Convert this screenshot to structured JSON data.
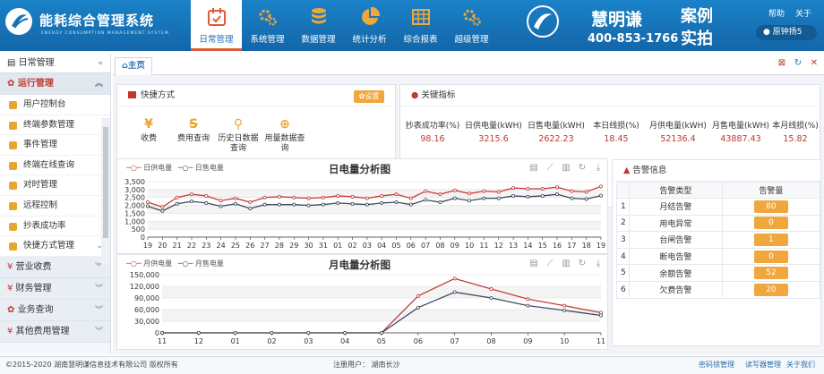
{
  "app": {
    "title": "能耗综合管理系统",
    "subtitle": "ENERGY CONSUMPTION MANAGEMENT SYSTEM"
  },
  "nav": [
    {
      "label": "日常管理",
      "icon": "calendar-icon",
      "active": true
    },
    {
      "label": "系统管理",
      "icon": "gears-icon"
    },
    {
      "label": "数据管理",
      "icon": "database-icon"
    },
    {
      "label": "统计分析",
      "icon": "pie-chart-icon"
    },
    {
      "label": "综合报表",
      "icon": "table-icon"
    },
    {
      "label": "超级管理",
      "icon": "gears-icon"
    }
  ],
  "brand": {
    "name": "慧明谦",
    "phone": "400-853-1766",
    "tagline": "案例实拍"
  },
  "header": {
    "help": "帮助",
    "about": "关于",
    "user": "原钟扬5"
  },
  "sidebar": {
    "title": "日常管理",
    "collapse_icon": "«",
    "open_section": "运行管理",
    "items": [
      "用户控制台",
      "终端参数管理",
      "事件管理",
      "终端在线查询",
      "对时管理",
      "远程控制",
      "抄表成功率",
      "快捷方式管理"
    ],
    "sections": [
      "营业收费",
      "财务管理",
      "业务查询",
      "其他费用管理"
    ]
  },
  "tabs": {
    "home": "主页"
  },
  "shortcuts": {
    "title": "快捷方式",
    "settings": "设置",
    "items": [
      {
        "label": "收费",
        "glyph": "¥"
      },
      {
        "label": "费用查询",
        "glyph": "S"
      },
      {
        "label": "历史日数据查询",
        "glyph": "Q"
      },
      {
        "label": "用量数据查询",
        "glyph": "Q"
      }
    ]
  },
  "kpi": {
    "title": "关键指标",
    "items": [
      {
        "label": "抄表成功率(%)",
        "value": "98.16"
      },
      {
        "label": "日供电量(kWH)",
        "value": "3215.6"
      },
      {
        "label": "日售电量(kWH)",
        "value": "2622.23"
      },
      {
        "label": "本日线损(%)",
        "value": "18.45"
      },
      {
        "label": "月供电量(kWH)",
        "value": "52136.4"
      },
      {
        "label": "月售电量(kWH)",
        "value": "43887.43"
      },
      {
        "label": "本月线损(%)",
        "value": "15.82"
      }
    ]
  },
  "colors": {
    "supply": "#c63c3a",
    "sale": "#3d4b5e",
    "accent": "#f0a73d",
    "header": "#1672b8"
  },
  "chart_data": [
    {
      "type": "line",
      "title": "日电量分析图",
      "x": [
        "19",
        "20",
        "21",
        "22",
        "23",
        "24",
        "25",
        "26",
        "27",
        "28",
        "29",
        "30",
        "31",
        "01",
        "02",
        "03",
        "04",
        "05",
        "06",
        "07",
        "08",
        "09",
        "10",
        "11",
        "12",
        "13",
        "14",
        "15",
        "16",
        "17",
        "18",
        "19"
      ],
      "series": [
        {
          "name": "日供电量",
          "values": [
            2200,
            1900,
            2500,
            2700,
            2600,
            2300,
            2450,
            2200,
            2500,
            2550,
            2500,
            2450,
            2500,
            2600,
            2550,
            2450,
            2600,
            2700,
            2450,
            2900,
            2700,
            2950,
            2750,
            2900,
            2850,
            3100,
            3050,
            3050,
            3150,
            2900,
            2850,
            3200
          ]
        },
        {
          "name": "日售电量",
          "values": [
            1950,
            1650,
            2100,
            2250,
            2150,
            1950,
            2100,
            1800,
            2050,
            2050,
            2050,
            2000,
            2050,
            2150,
            2100,
            2050,
            2150,
            2200,
            2050,
            2350,
            2200,
            2450,
            2300,
            2450,
            2450,
            2600,
            2550,
            2600,
            2700,
            2450,
            2400,
            2620
          ]
        }
      ],
      "ylim": [
        0,
        3500
      ],
      "yticks": [
        "0",
        "500",
        "1,000",
        "1,500",
        "2,000",
        "2,500",
        "3,000",
        "3,500"
      ]
    },
    {
      "type": "line",
      "title": "月电量分析图",
      "x": [
        "11",
        "12",
        "01",
        "02",
        "03",
        "04",
        "05",
        "06",
        "07",
        "08",
        "09",
        "10",
        "11"
      ],
      "series": [
        {
          "name": "月供电量",
          "values": [
            0,
            0,
            0,
            0,
            0,
            0,
            0,
            95000,
            140000,
            113000,
            87000,
            70000,
            52000
          ]
        },
        {
          "name": "月售电量",
          "values": [
            0,
            0,
            0,
            0,
            0,
            0,
            0,
            65000,
            105000,
            90000,
            70000,
            58000,
            45000
          ]
        }
      ],
      "ylim": [
        0,
        150000
      ],
      "yticks": [
        "0",
        "30,000",
        "60,000",
        "90,000",
        "120,000",
        "150,000"
      ]
    }
  ],
  "alarm": {
    "title": "告警信息",
    "headers": [
      "告警类型",
      "告警量"
    ],
    "rows": [
      {
        "no": "1",
        "type": "月结告警",
        "count": "80"
      },
      {
        "no": "2",
        "type": "用电异常",
        "count": "0"
      },
      {
        "no": "3",
        "type": "台闸告警",
        "count": "1"
      },
      {
        "no": "4",
        "type": "断电告警",
        "count": "0"
      },
      {
        "no": "5",
        "type": "余额告警",
        "count": "52"
      },
      {
        "no": "6",
        "type": "欠费告警",
        "count": "20"
      }
    ]
  },
  "footer": {
    "copyright": "©2015-2020 湖南慧明谦信息技术有限公司 版权所有",
    "registered": "注册用户： 湖南长沙",
    "links": [
      "密码锁管理",
      "读写器管理",
      "关于我们"
    ]
  }
}
